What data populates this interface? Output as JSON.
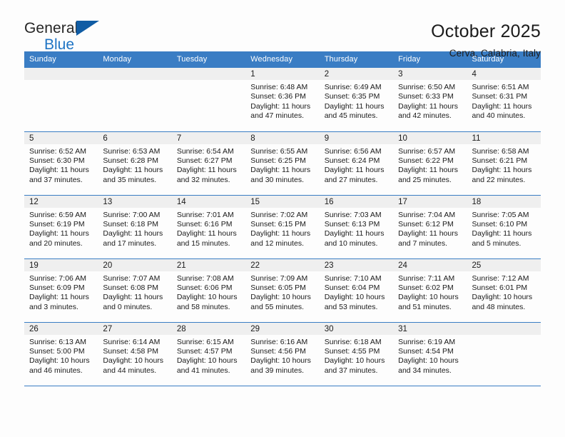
{
  "brand": {
    "name_top": "General",
    "name_bottom": "Blue",
    "triangle_color": "#105ca4",
    "blue_text_color": "#1e74c4"
  },
  "header": {
    "title": "October 2025",
    "subtitle": "Cerva, Calabria, Italy"
  },
  "colors": {
    "header_blue": "#3a7dc4",
    "daynum_band": "#efefef",
    "page_background": "#fdfdfd",
    "text": "#1a1a1a"
  },
  "weekdays": [
    "Sunday",
    "Monday",
    "Tuesday",
    "Wednesday",
    "Thursday",
    "Friday",
    "Saturday"
  ],
  "labels": {
    "sunrise_prefix": "Sunrise:",
    "sunset_prefix": "Sunset:",
    "daylight_prefix": "Daylight:"
  },
  "weeks": [
    [
      {
        "empty": true
      },
      {
        "empty": true
      },
      {
        "empty": true
      },
      {
        "day": "1",
        "sunrise": "Sunrise: 6:48 AM",
        "sunset": "Sunset: 6:36 PM",
        "daylight_line1": "Daylight: 11 hours",
        "daylight_line2": "and 47 minutes."
      },
      {
        "day": "2",
        "sunrise": "Sunrise: 6:49 AM",
        "sunset": "Sunset: 6:35 PM",
        "daylight_line1": "Daylight: 11 hours",
        "daylight_line2": "and 45 minutes."
      },
      {
        "day": "3",
        "sunrise": "Sunrise: 6:50 AM",
        "sunset": "Sunset: 6:33 PM",
        "daylight_line1": "Daylight: 11 hours",
        "daylight_line2": "and 42 minutes."
      },
      {
        "day": "4",
        "sunrise": "Sunrise: 6:51 AM",
        "sunset": "Sunset: 6:31 PM",
        "daylight_line1": "Daylight: 11 hours",
        "daylight_line2": "and 40 minutes."
      }
    ],
    [
      {
        "day": "5",
        "sunrise": "Sunrise: 6:52 AM",
        "sunset": "Sunset: 6:30 PM",
        "daylight_line1": "Daylight: 11 hours",
        "daylight_line2": "and 37 minutes."
      },
      {
        "day": "6",
        "sunrise": "Sunrise: 6:53 AM",
        "sunset": "Sunset: 6:28 PM",
        "daylight_line1": "Daylight: 11 hours",
        "daylight_line2": "and 35 minutes."
      },
      {
        "day": "7",
        "sunrise": "Sunrise: 6:54 AM",
        "sunset": "Sunset: 6:27 PM",
        "daylight_line1": "Daylight: 11 hours",
        "daylight_line2": "and 32 minutes."
      },
      {
        "day": "8",
        "sunrise": "Sunrise: 6:55 AM",
        "sunset": "Sunset: 6:25 PM",
        "daylight_line1": "Daylight: 11 hours",
        "daylight_line2": "and 30 minutes."
      },
      {
        "day": "9",
        "sunrise": "Sunrise: 6:56 AM",
        "sunset": "Sunset: 6:24 PM",
        "daylight_line1": "Daylight: 11 hours",
        "daylight_line2": "and 27 minutes."
      },
      {
        "day": "10",
        "sunrise": "Sunrise: 6:57 AM",
        "sunset": "Sunset: 6:22 PM",
        "daylight_line1": "Daylight: 11 hours",
        "daylight_line2": "and 25 minutes."
      },
      {
        "day": "11",
        "sunrise": "Sunrise: 6:58 AM",
        "sunset": "Sunset: 6:21 PM",
        "daylight_line1": "Daylight: 11 hours",
        "daylight_line2": "and 22 minutes."
      }
    ],
    [
      {
        "day": "12",
        "sunrise": "Sunrise: 6:59 AM",
        "sunset": "Sunset: 6:19 PM",
        "daylight_line1": "Daylight: 11 hours",
        "daylight_line2": "and 20 minutes."
      },
      {
        "day": "13",
        "sunrise": "Sunrise: 7:00 AM",
        "sunset": "Sunset: 6:18 PM",
        "daylight_line1": "Daylight: 11 hours",
        "daylight_line2": "and 17 minutes."
      },
      {
        "day": "14",
        "sunrise": "Sunrise: 7:01 AM",
        "sunset": "Sunset: 6:16 PM",
        "daylight_line1": "Daylight: 11 hours",
        "daylight_line2": "and 15 minutes."
      },
      {
        "day": "15",
        "sunrise": "Sunrise: 7:02 AM",
        "sunset": "Sunset: 6:15 PM",
        "daylight_line1": "Daylight: 11 hours",
        "daylight_line2": "and 12 minutes."
      },
      {
        "day": "16",
        "sunrise": "Sunrise: 7:03 AM",
        "sunset": "Sunset: 6:13 PM",
        "daylight_line1": "Daylight: 11 hours",
        "daylight_line2": "and 10 minutes."
      },
      {
        "day": "17",
        "sunrise": "Sunrise: 7:04 AM",
        "sunset": "Sunset: 6:12 PM",
        "daylight_line1": "Daylight: 11 hours",
        "daylight_line2": "and 7 minutes."
      },
      {
        "day": "18",
        "sunrise": "Sunrise: 7:05 AM",
        "sunset": "Sunset: 6:10 PM",
        "daylight_line1": "Daylight: 11 hours",
        "daylight_line2": "and 5 minutes."
      }
    ],
    [
      {
        "day": "19",
        "sunrise": "Sunrise: 7:06 AM",
        "sunset": "Sunset: 6:09 PM",
        "daylight_line1": "Daylight: 11 hours",
        "daylight_line2": "and 3 minutes."
      },
      {
        "day": "20",
        "sunrise": "Sunrise: 7:07 AM",
        "sunset": "Sunset: 6:08 PM",
        "daylight_line1": "Daylight: 11 hours",
        "daylight_line2": "and 0 minutes."
      },
      {
        "day": "21",
        "sunrise": "Sunrise: 7:08 AM",
        "sunset": "Sunset: 6:06 PM",
        "daylight_line1": "Daylight: 10 hours",
        "daylight_line2": "and 58 minutes."
      },
      {
        "day": "22",
        "sunrise": "Sunrise: 7:09 AM",
        "sunset": "Sunset: 6:05 PM",
        "daylight_line1": "Daylight: 10 hours",
        "daylight_line2": "and 55 minutes."
      },
      {
        "day": "23",
        "sunrise": "Sunrise: 7:10 AM",
        "sunset": "Sunset: 6:04 PM",
        "daylight_line1": "Daylight: 10 hours",
        "daylight_line2": "and 53 minutes."
      },
      {
        "day": "24",
        "sunrise": "Sunrise: 7:11 AM",
        "sunset": "Sunset: 6:02 PM",
        "daylight_line1": "Daylight: 10 hours",
        "daylight_line2": "and 51 minutes."
      },
      {
        "day": "25",
        "sunrise": "Sunrise: 7:12 AM",
        "sunset": "Sunset: 6:01 PM",
        "daylight_line1": "Daylight: 10 hours",
        "daylight_line2": "and 48 minutes."
      }
    ],
    [
      {
        "day": "26",
        "sunrise": "Sunrise: 6:13 AM",
        "sunset": "Sunset: 5:00 PM",
        "daylight_line1": "Daylight: 10 hours",
        "daylight_line2": "and 46 minutes."
      },
      {
        "day": "27",
        "sunrise": "Sunrise: 6:14 AM",
        "sunset": "Sunset: 4:58 PM",
        "daylight_line1": "Daylight: 10 hours",
        "daylight_line2": "and 44 minutes."
      },
      {
        "day": "28",
        "sunrise": "Sunrise: 6:15 AM",
        "sunset": "Sunset: 4:57 PM",
        "daylight_line1": "Daylight: 10 hours",
        "daylight_line2": "and 41 minutes."
      },
      {
        "day": "29",
        "sunrise": "Sunrise: 6:16 AM",
        "sunset": "Sunset: 4:56 PM",
        "daylight_line1": "Daylight: 10 hours",
        "daylight_line2": "and 39 minutes."
      },
      {
        "day": "30",
        "sunrise": "Sunrise: 6:18 AM",
        "sunset": "Sunset: 4:55 PM",
        "daylight_line1": "Daylight: 10 hours",
        "daylight_line2": "and 37 minutes."
      },
      {
        "day": "31",
        "sunrise": "Sunrise: 6:19 AM",
        "sunset": "Sunset: 4:54 PM",
        "daylight_line1": "Daylight: 10 hours",
        "daylight_line2": "and 34 minutes."
      },
      {
        "empty": true
      }
    ]
  ]
}
